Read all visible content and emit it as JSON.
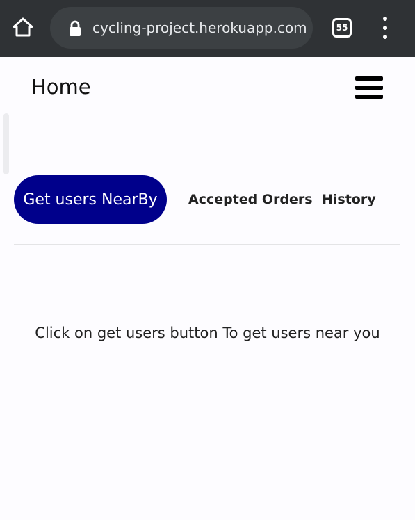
{
  "browser": {
    "url": "cycling-project.herokuapp.com",
    "tab_count": "55",
    "home_icon": "home-icon",
    "lock_icon": "lock-icon",
    "menu_icon": "more-vert-icon"
  },
  "header": {
    "title": "Home",
    "menu_icon": "hamburger-icon"
  },
  "tabs": [
    {
      "label": "Get users NearBy",
      "active": true
    },
    {
      "label": "Accepted Orders",
      "active": false
    },
    {
      "label": "History",
      "active": false
    }
  ],
  "content": {
    "message": "Click on get users button To get users near you"
  },
  "colors": {
    "active_tab": "#00008b",
    "browser_bar": "#2f3235"
  }
}
